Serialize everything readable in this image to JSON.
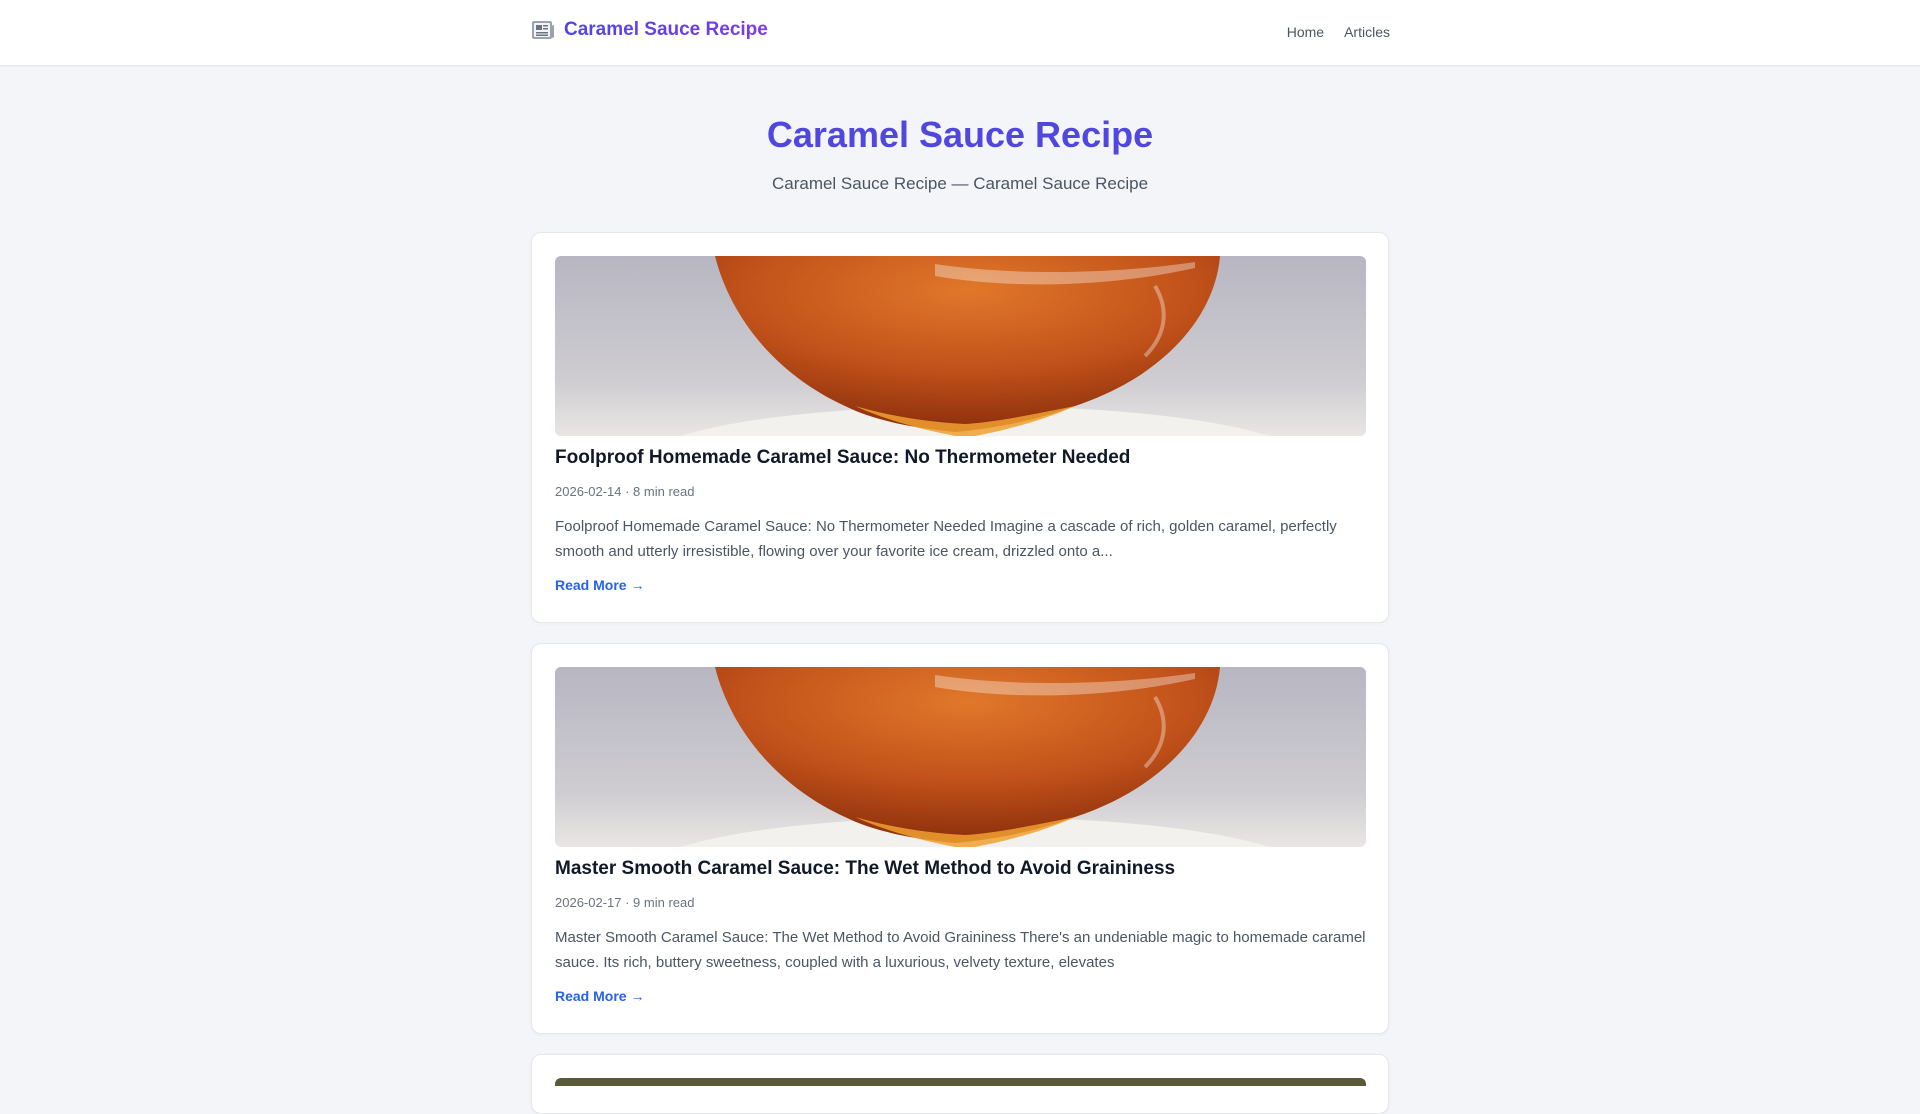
{
  "header": {
    "brand_icon": "newspaper-icon",
    "brand_title": "Caramel Sauce Recipe",
    "nav": [
      {
        "label": "Home"
      },
      {
        "label": "Articles"
      }
    ]
  },
  "hero": {
    "title": "Caramel Sauce Recipe",
    "subtitle": "Caramel Sauce Recipe — Caramel Sauce Recipe"
  },
  "articles": [
    {
      "title": "Foolproof Homemade Caramel Sauce: No Thermometer Needed",
      "meta": "2026-02-14 · 8 min read",
      "excerpt": "Foolproof Homemade Caramel Sauce: No Thermometer Needed Imagine a cascade of rich, golden caramel, perfectly smooth and utterly irresistible, flowing over your favorite ice cream, drizzled onto a...",
      "link": "Read More →"
    },
    {
      "title": "Master Smooth Caramel Sauce: The Wet Method to Avoid Graininess",
      "meta": "2026-02-17 · 9 min read",
      "excerpt": "Master Smooth Caramel Sauce: The Wet Method to Avoid Graininess There's an undeniable magic to homemade caramel sauce. Its rich, buttery sweetness, coupled with a luxurious, velvety texture, elevates",
      "link": "Read More →"
    }
  ],
  "colors": {
    "accent": "#5046e0",
    "link": "#2563eb",
    "background": "#f4f5f8"
  }
}
